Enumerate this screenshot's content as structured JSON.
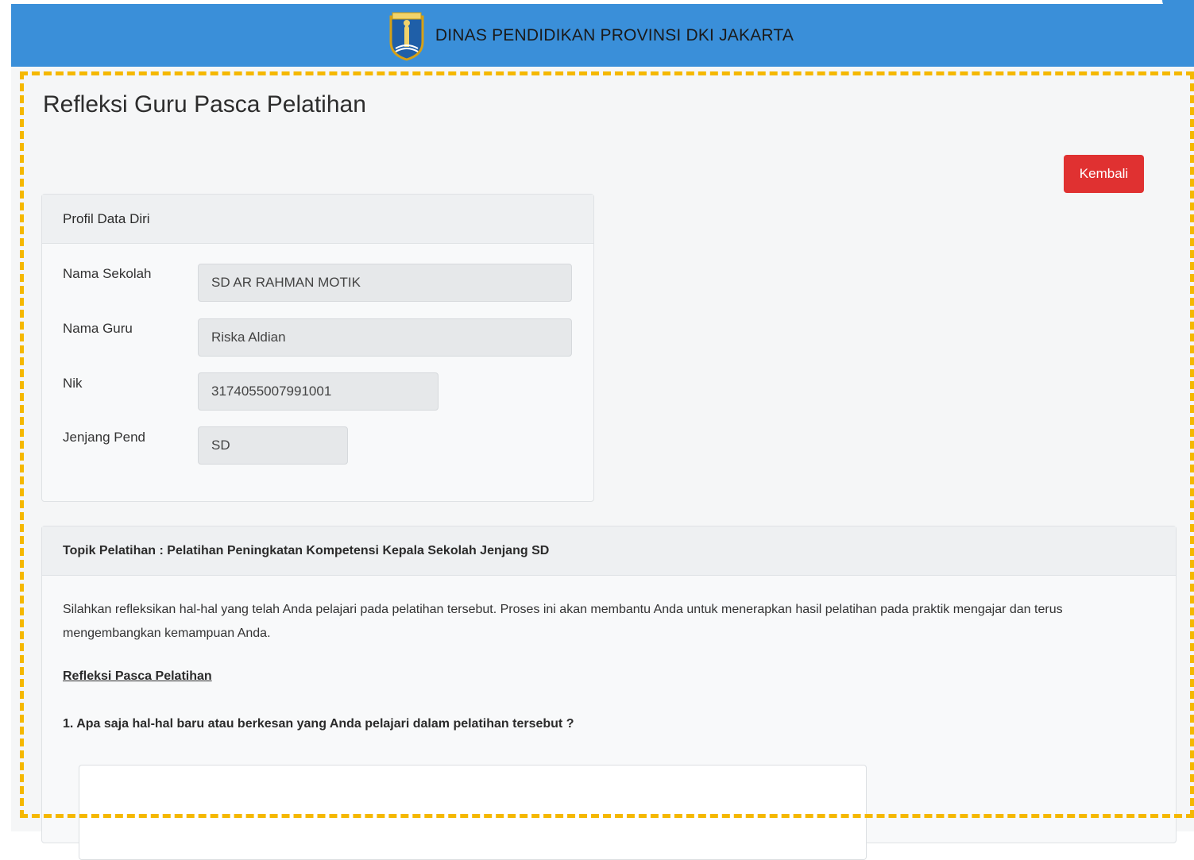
{
  "header": {
    "title": "DINAS PENDIDIKAN PROVINSI DKI JAKARTA",
    "logo_icon": "dki-jakarta-crest-icon",
    "bar_color": "#3a8fd9"
  },
  "page": {
    "title": "Refleksi Guru Pasca Pelatihan",
    "back_button": "Kembali",
    "back_button_color": "#e03131"
  },
  "profile": {
    "header": "Profil Data Diri",
    "fields": [
      {
        "label": "Nama Sekolah",
        "value": "SD AR RAHMAN MOTIK"
      },
      {
        "label": "Nama Guru",
        "value": "Riska Aldian"
      },
      {
        "label": "Nik",
        "value": "3174055007991001"
      },
      {
        "label": "Jenjang Pend",
        "value": "SD"
      }
    ]
  },
  "topic": {
    "header": "Topik Pelatihan : Pelatihan Peningkatan Kompetensi Kepala Sekolah Jenjang SD",
    "description": "Silahkan refleksikan hal-hal yang telah Anda pelajari pada pelatihan tersebut. Proses ini akan membantu Anda untuk menerapkan hasil pelatihan pada praktik mengajar dan terus mengembangkan kemampuan Anda.",
    "section_title": "Refleksi Pasca Pelatihan",
    "question_1": "1. Apa saja hal-hal baru atau berkesan yang Anda pelajari dalam pelatihan tersebut ?",
    "answer_1": ""
  },
  "highlight_color": "#f5b800"
}
